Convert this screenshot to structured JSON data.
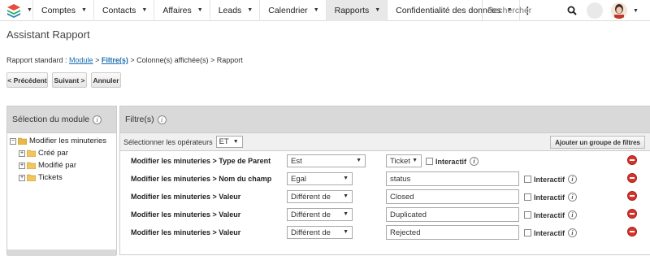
{
  "nav": {
    "items": [
      {
        "label": "Comptes"
      },
      {
        "label": "Contacts"
      },
      {
        "label": "Affaires"
      },
      {
        "label": "Leads"
      },
      {
        "label": "Calendrier"
      },
      {
        "label": "Rapports",
        "active": true
      },
      {
        "label": "Confidentialité des données"
      }
    ],
    "search_placeholder": "Rechercher"
  },
  "page": {
    "title": "Assistant Rapport",
    "breadcrumb": {
      "prefix": "Rapport standard : ",
      "module": "Module",
      "sep1": " > ",
      "filtres": "Filtre(s)",
      "rest": " > Colonne(s) affichée(s) > Rapport"
    }
  },
  "buttons": {
    "prev": "< Précédent",
    "next": "Suivant >",
    "cancel": "Annuler"
  },
  "module_panel": {
    "title": "Sélection du module",
    "root": "Modifier les minuteries",
    "children": [
      "Créé par",
      "Modifié par",
      "Tickets"
    ]
  },
  "filter_panel": {
    "title": "Filtre(s)",
    "operators_label": "Sélectionner les opérateurs",
    "operator_value": "ET",
    "add_group": "Ajouter un groupe de filtres",
    "interactif_label": "Interactif",
    "rows": [
      {
        "field": "Modifier les minuteries > Type de Parent",
        "operator": "Est",
        "value": "Ticket"
      },
      {
        "field": "Modifier les minuteries > Nom du champ",
        "operator": "Egal",
        "value": "status"
      },
      {
        "field": "Modifier les minuteries > Valeur",
        "operator": "Différent de",
        "value": "Closed"
      },
      {
        "field": "Modifier les minuteries > Valeur",
        "operator": "Différent de",
        "value": "Duplicated"
      },
      {
        "field": "Modifier les minuteries > Valeur",
        "operator": "Différent de",
        "value": "Rejected"
      }
    ]
  },
  "colors": {
    "remove": "#d9342b",
    "link": "#1a6fb0",
    "panel_header": "#d9d9d9"
  }
}
